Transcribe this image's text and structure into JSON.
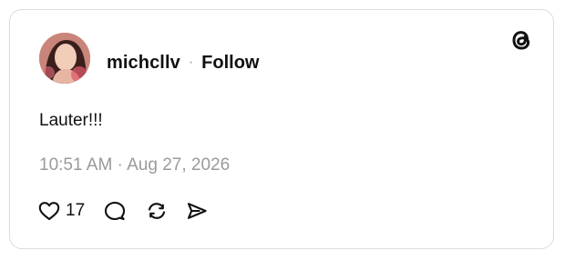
{
  "post": {
    "username": "michcllv",
    "separator": "·",
    "follow_label": "Follow",
    "text": "Lauter!!!",
    "timestamp": "10:51 AM · Aug 27, 2026",
    "like_count": "17"
  },
  "icons": {
    "brand": "threads-logo-icon",
    "like": "heart-icon",
    "reply": "comment-icon",
    "repost": "repost-icon",
    "share": "send-icon"
  },
  "colors": {
    "text": "#111111",
    "muted": "#9a9a9a",
    "border": "#dcdcdc"
  }
}
